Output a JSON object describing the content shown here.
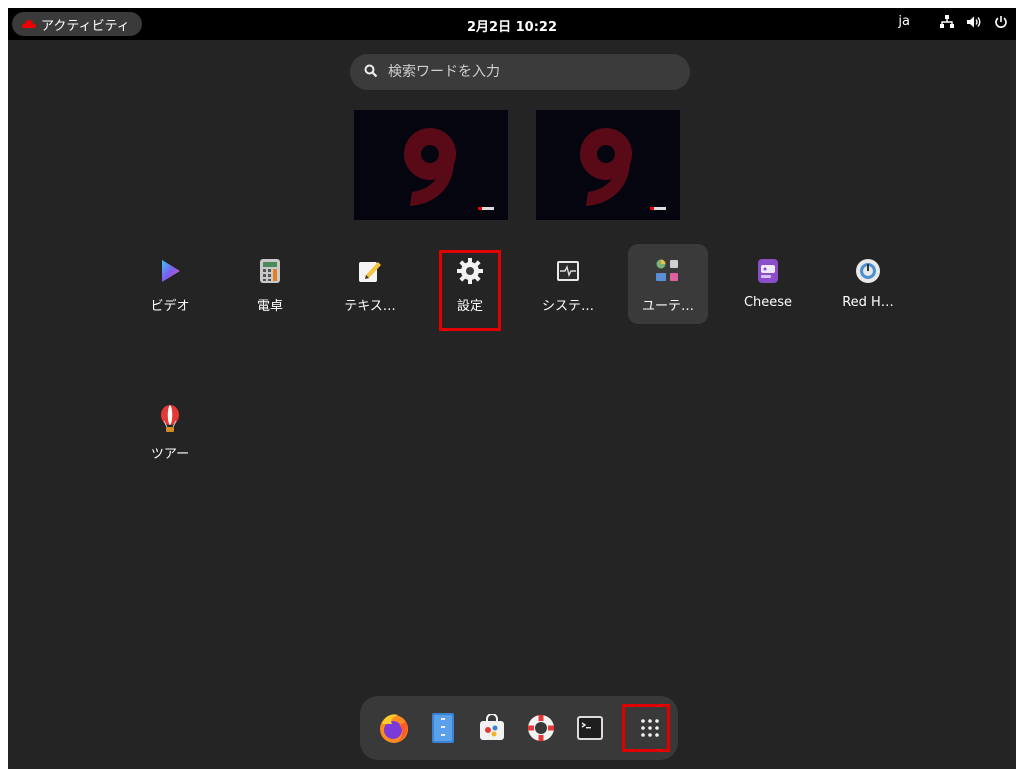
{
  "topbar": {
    "activities_label": "アクティビティ",
    "clock": "2月2日 10:22",
    "input_source": "ja",
    "icons": [
      "network-icon",
      "volume-icon",
      "power-icon"
    ]
  },
  "search": {
    "placeholder": "検索ワードを入力",
    "value": ""
  },
  "apps": [
    {
      "label": "ビデオ",
      "icon": "video-icon"
    },
    {
      "label": "電卓",
      "icon": "calculator-icon"
    },
    {
      "label": "テキス…",
      "icon": "text-editor-icon"
    },
    {
      "label": "設定",
      "icon": "settings-gear-icon",
      "highlighted": true
    },
    {
      "label": "システ…",
      "icon": "system-monitor-icon"
    },
    {
      "label": "ユーテ…",
      "icon": "utilities-folder-icon",
      "hovered": true
    },
    {
      "label": "Cheese",
      "icon": "cheese-icon"
    },
    {
      "label": "Red H…",
      "icon": "red-hat-insights-icon"
    },
    {
      "label": "ツアー",
      "icon": "tour-balloon-icon"
    }
  ],
  "dock": [
    "firefox-icon",
    "files-icon",
    "software-icon",
    "help-icon",
    "terminal-icon",
    "show-apps-icon"
  ],
  "colors": {
    "highlight": "#e00000",
    "background": "#242424",
    "topbar": "#000000"
  }
}
